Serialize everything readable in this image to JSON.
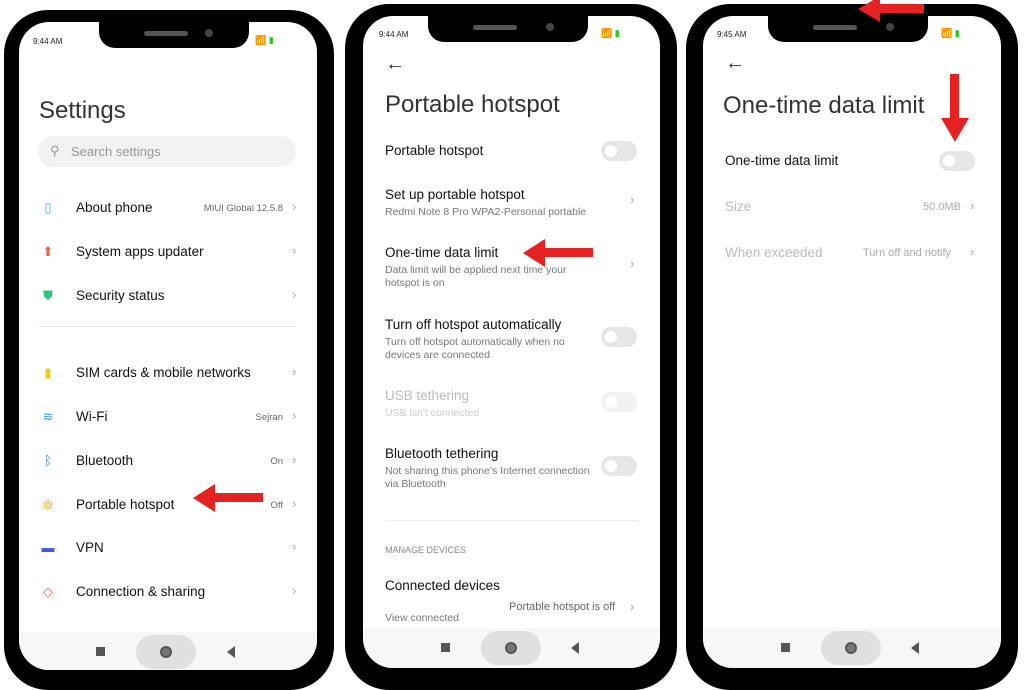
{
  "status": [
    {
      "time": "9:44 AM"
    },
    {
      "time": "9:44 AM"
    },
    {
      "time": "9:45 AM"
    }
  ],
  "settings": {
    "title": "Settings",
    "search_placeholder": "Search settings",
    "items": [
      {
        "label": "About phone",
        "value": "MIUI Global 12.5.8",
        "icon": "phone-icon",
        "color": "#3fa9f5"
      },
      {
        "label": "System apps updater",
        "value": "",
        "icon": "arrow-up-icon",
        "color": "#f25c3b"
      },
      {
        "label": "Security status",
        "value": "",
        "icon": "shield-check-icon",
        "color": "#2ec27e"
      },
      {
        "label": "SIM cards & mobile networks",
        "value": "",
        "icon": "sim-icon",
        "color": "#f5c518"
      },
      {
        "label": "Wi-Fi",
        "value": "Sejran",
        "icon": "wifi-icon",
        "color": "#2aa3f0"
      },
      {
        "label": "Bluetooth",
        "value": "On",
        "icon": "bluetooth-icon",
        "color": "#2a7fe0"
      },
      {
        "label": "Portable hotspot",
        "value": "Off",
        "icon": "hotspot-icon",
        "color": "#f2b01e"
      },
      {
        "label": "VPN",
        "value": "",
        "icon": "vpn-icon",
        "color": "#3b5bd9"
      },
      {
        "label": "Connection & sharing",
        "value": "",
        "icon": "share-icon",
        "color": "#f25c3b"
      }
    ]
  },
  "hotspot": {
    "title": "Portable hotspot",
    "rows": [
      {
        "label": "Portable hotspot",
        "sub": "",
        "control": "toggle-off"
      },
      {
        "label": "Set up portable hotspot",
        "sub": "Redmi Note 8 Pro WPA2-Personal portable",
        "control": "chevron"
      },
      {
        "label": "One-time data limit",
        "sub": "Data limit will be applied next time your hotspot is on",
        "control": "chevron"
      },
      {
        "label": "Turn off hotspot automatically",
        "sub": "Turn off hotspot automatically when no devices are connected",
        "control": "toggle-off"
      },
      {
        "label": "USB tethering",
        "sub": "USB isn't connected",
        "control": "toggle-disabled"
      },
      {
        "label": "Bluetooth tethering",
        "sub": "Not sharing this phone's Internet connection via Bluetooth",
        "control": "toggle-off"
      }
    ],
    "section": "MANAGE DEVICES",
    "connected": {
      "label": "Connected devices",
      "sub": "View connected",
      "value": "Portable hotspot is off"
    }
  },
  "limit": {
    "title": "One-time data limit",
    "rows": [
      {
        "label": "One-time data limit",
        "control": "toggle-off"
      },
      {
        "label": "Size",
        "value": "50.0MB"
      },
      {
        "label": "When exceeded",
        "value": "Turn off and notify"
      }
    ]
  },
  "accent": "#e52222"
}
